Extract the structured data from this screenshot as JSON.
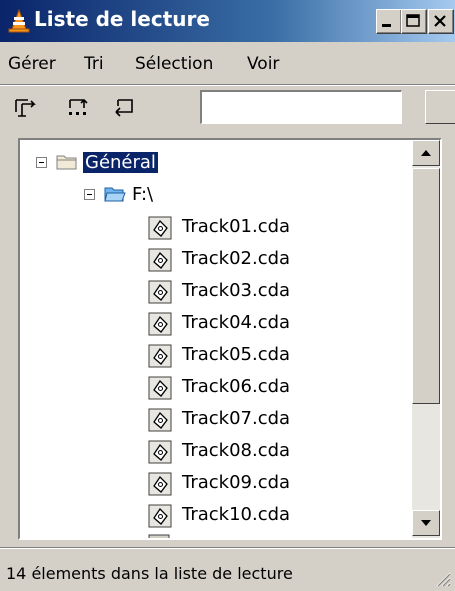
{
  "window": {
    "title": "Liste de lecture"
  },
  "menu": [
    "Gérer",
    "Tri",
    "Sélection",
    "Voir"
  ],
  "search": {
    "value": ""
  },
  "tree": {
    "root": {
      "label": "Général",
      "selected": true
    },
    "folder": {
      "label": "F:\\"
    },
    "tracks": [
      "Track01.cda",
      "Track02.cda",
      "Track03.cda",
      "Track04.cda",
      "Track05.cda",
      "Track06.cda",
      "Track07.cda",
      "Track08.cda",
      "Track09.cda",
      "Track10.cda"
    ]
  },
  "status": {
    "text": "14 élements dans la liste de lecture"
  },
  "colors": {
    "selection": "#0a246a",
    "window_bg": "#d4d0c8",
    "title_gradient_start": "#0a246a",
    "title_gradient_end": "#a6caf0"
  },
  "icons": {
    "app": "vlc-cone-icon",
    "root": "folder-icon",
    "folder": "open-folder-icon",
    "track": "cd-track-icon"
  }
}
